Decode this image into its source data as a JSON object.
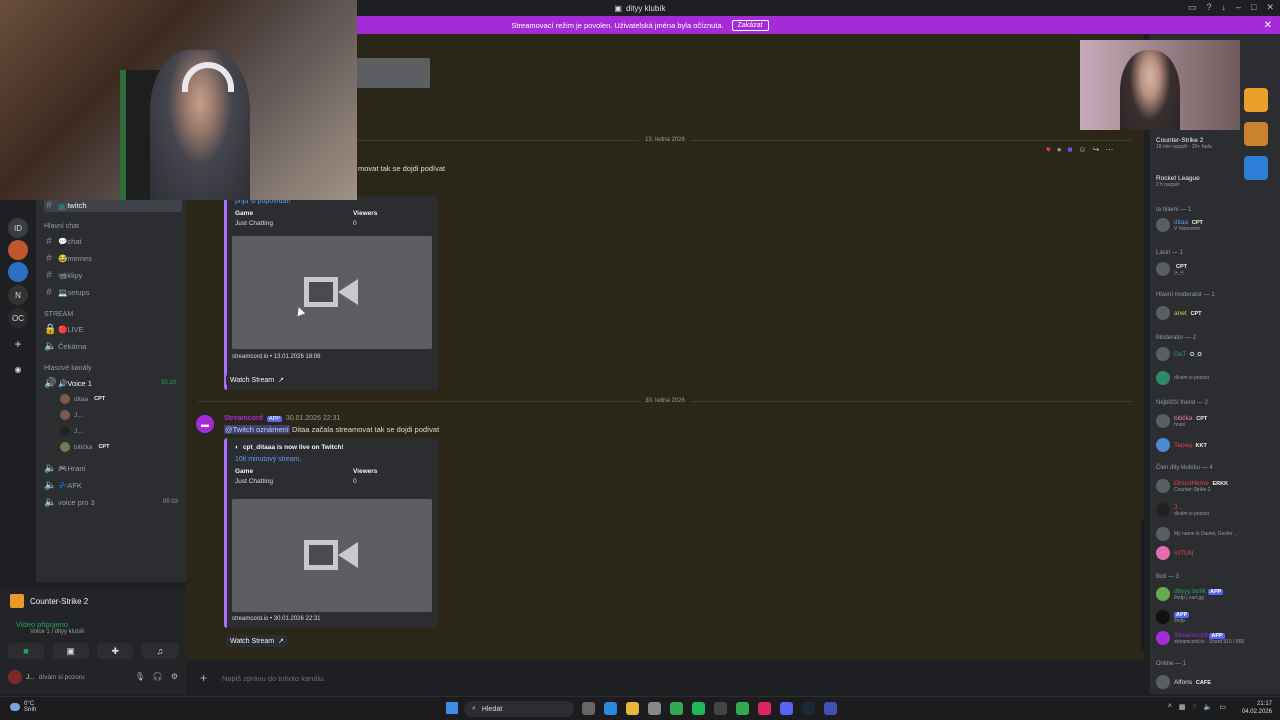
{
  "window": {
    "title": "dityy klubík"
  },
  "banner": {
    "text": "Streamovací režim je povolen. Uživatelská jména byla očíznuta.",
    "button": "Zakázat"
  },
  "sidebar": {
    "channels": [
      {
        "label": "📺twitch"
      },
      {
        "label": "💬chat"
      },
      {
        "label": "😂memes"
      },
      {
        "label": "📹klipy"
      },
      {
        "label": "💻setups"
      },
      {
        "label": "🔴LIVE"
      },
      {
        "label": "Čekárna"
      },
      {
        "label": "🔊Voice 1"
      },
      {
        "label": "🎮Hraní"
      },
      {
        "label": "💤AFK"
      },
      {
        "label": "voice pro 3"
      }
    ],
    "categories": {
      "main_chat": "Hlavní chat",
      "stream": "STREAM",
      "voice": "Hlasové kanály"
    },
    "voice_timer": "50:10",
    "voice_users": [
      {
        "name": "ditaa",
        "tag": "CPT"
      },
      {
        "name": "J..."
      },
      {
        "name": "J..."
      },
      {
        "name": "bitička",
        "tag": "CPT"
      }
    ],
    "voice3_count": "00 03"
  },
  "userpanel": {
    "game": "Counter-Strike 2",
    "voice_status": "Video připojeno",
    "voice_sub": "Voice 1 / dityy klubík",
    "me_name": "J...",
    "me_status": "dívám si pozoru"
  },
  "chat": {
    "date1": "13. ledna 2026",
    "msg1_text": "movat tak se dojdi podívat",
    "embed1": {
      "cta": "přijď si popovídat!",
      "game_key": "Game",
      "game_val": "Just Chatting",
      "viewers_key": "Viewers",
      "viewers_val": "0",
      "footer": "streamcord.io • 13.01.2026 18:06",
      "watch": "Watch Stream"
    },
    "date2": "30. ledna 2026",
    "msg2": {
      "author": "Streamcord",
      "app": "APP",
      "time": "30.01.2026 22:31",
      "mention": "@Twitch oznámení",
      "text": "Ditaa začala streamovat tak se dojdi podívat"
    },
    "embed2": {
      "title": "cpt_ditaaa is now live on Twitch!",
      "sub": "10ti minutový stream.",
      "game_key": "Game",
      "game_val": "Just Chatting",
      "viewers_key": "Viewers",
      "viewers_val": "0",
      "footer": "streamcord.io • 30.01.2026 22:31",
      "watch": "Watch Stream"
    },
    "composer_placeholder": "Napiš zprávu do tohoto kanálu."
  },
  "members": {
    "activities": [
      {
        "name": "Counter-Strike 2",
        "sub": "18 min nazpět · 20+ řada"
      },
      {
        "name": "Rocket League",
        "sub": "2 h nazpět"
      }
    ],
    "groups": [
      {
        "label": "ta hlavní — 1"
      },
      {
        "label": "Lasin — 1"
      },
      {
        "label": "Hlavní moderator — 1"
      },
      {
        "label": "Moderator — 2"
      },
      {
        "label": "Nejbližší friend — 2"
      },
      {
        "label": "Člen dity klubíku — 4"
      },
      {
        "label": "Boti — 3"
      },
      {
        "label": "Online — 1"
      }
    ],
    "list": [
      {
        "name": "ditaa",
        "tag": "CPT",
        "sub": "V hlasovém"
      },
      {
        "name": "",
        "tag": "CPT",
        "sub": "(•_•)"
      },
      {
        "name": "anet",
        "tag": "CPT",
        "sub": ""
      },
      {
        "name": "DeT",
        "tag": "O_O",
        "sub": ""
      },
      {
        "name": "",
        "tag": "",
        "sub": "dívám si pozoru"
      },
      {
        "name": "bitička",
        "tag": "CPT",
        "sub": "hraní"
      },
      {
        "name": "Tepeq",
        "tag": "KKT",
        "sub": ""
      },
      {
        "name": "GhostHeme",
        "tag": "ERKK",
        "sub": "Counter-Strike 2"
      },
      {
        "name": "J...",
        "tag": "",
        "sub": "dívám si pozoru"
      },
      {
        "name": "",
        "tag": "",
        "sub": "My name is Daniel, Dexter ..."
      },
      {
        "name": "VITUN",
        "tag": "",
        "sub": ""
      },
      {
        "name": "dityyy botik",
        "tag": "APP",
        "sub": "/help | carl.gg"
      },
      {
        "name": "",
        "tag": "APP",
        "sub": "/help"
      },
      {
        "name": "Streamcord",
        "tag": "APP",
        "sub": "streamcord.io · Shard 515 / 800"
      },
      {
        "name": "Alfons",
        "tag": "CAFE",
        "sub": ""
      }
    ]
  },
  "taskbar": {
    "weather_temp": "0°C",
    "weather_desc": "Sníh",
    "search": "Hledat",
    "time": "21:17",
    "date": "04.02.2026"
  }
}
